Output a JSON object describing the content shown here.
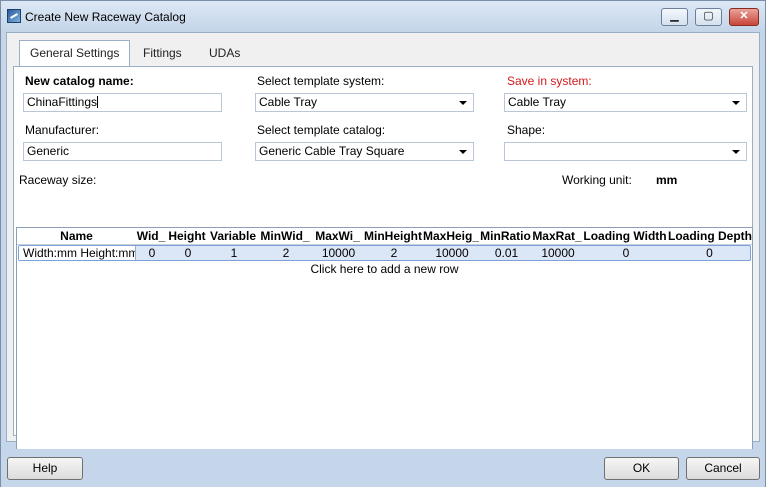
{
  "window": {
    "title": "Create New Raceway Catalog",
    "minimize_glyph": "▁",
    "maximize_glyph": "▢",
    "close_glyph": "✕"
  },
  "tabs": [
    {
      "label": "General Settings",
      "active": true
    },
    {
      "label": "Fittings",
      "active": false
    },
    {
      "label": "UDAs",
      "active": false
    }
  ],
  "general": {
    "catalog_name_label": "New catalog name:",
    "catalog_name_value": "ChinaFittings",
    "template_system_label": "Select template system:",
    "template_system_value": "Cable Tray",
    "save_in_system_label": "Save in system:",
    "save_in_system_value": "Cable Tray",
    "manufacturer_label": "Manufacturer:",
    "manufacturer_value": "Generic",
    "template_catalog_label": "Select template catalog:",
    "template_catalog_value": "Generic Cable Tray Square",
    "shape_label": "Shape:",
    "shape_value": "",
    "raceway_size_label": "Raceway size:",
    "working_unit_label": "Working unit:",
    "working_unit_value": "mm"
  },
  "grid": {
    "columns": [
      "Name",
      "Wid_",
      "Height",
      "Variable",
      "MinWid_",
      "MaxWi_",
      "MinHeight",
      "MaxHeig_",
      "MinRatio",
      "MaxRat_",
      "Loading Width",
      "Loading Depth"
    ],
    "rows": [
      [
        "Width:mm Height:mm",
        "0",
        "0",
        "1",
        "2",
        "10000",
        "2",
        "10000",
        "0.01",
        "10000",
        "0",
        "0"
      ]
    ],
    "add_row_text": "Click here to add a new row"
  },
  "buttons": {
    "help": "Help",
    "ok": "OK",
    "cancel": "Cancel"
  },
  "colors": {
    "required_label": "#d11a1a",
    "selected_row": "#dbe7f6"
  }
}
